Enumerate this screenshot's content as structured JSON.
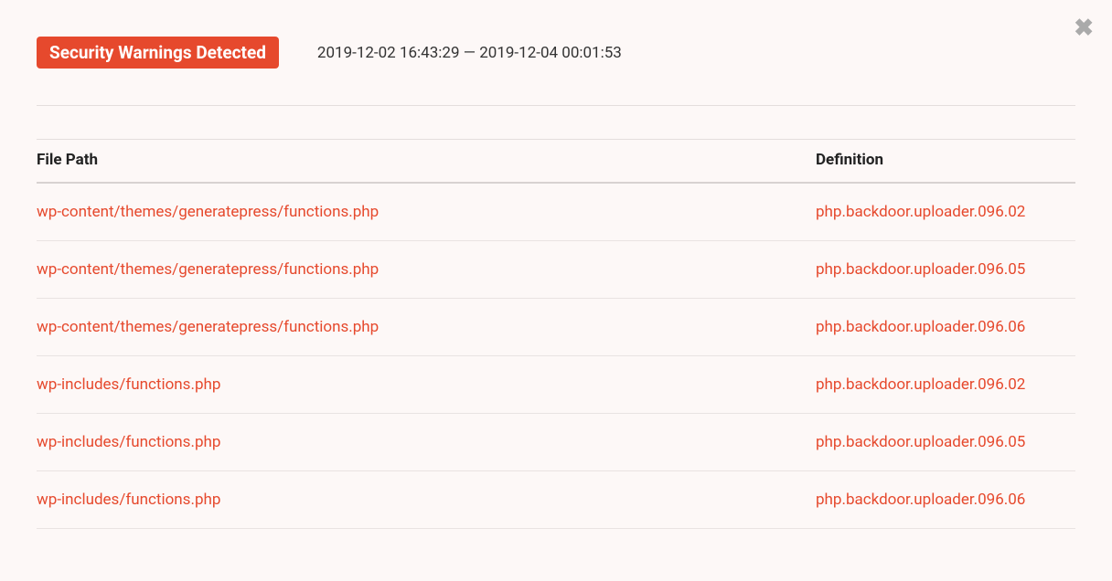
{
  "header": {
    "badge_label": "Security Warnings Detected",
    "timestamp_range": "2019-12-02 16:43:29 — 2019-12-04 00:01:53"
  },
  "close_icon": "✖",
  "table": {
    "columns": {
      "file_path": "File Path",
      "definition": "Definition"
    },
    "rows": [
      {
        "file_path": "wp-content/themes/generatepress/functions.php",
        "definition": "php.backdoor.uploader.096.02"
      },
      {
        "file_path": "wp-content/themes/generatepress/functions.php",
        "definition": "php.backdoor.uploader.096.05"
      },
      {
        "file_path": "wp-content/themes/generatepress/functions.php",
        "definition": "php.backdoor.uploader.096.06"
      },
      {
        "file_path": "wp-includes/functions.php",
        "definition": "php.backdoor.uploader.096.02"
      },
      {
        "file_path": "wp-includes/functions.php",
        "definition": "php.backdoor.uploader.096.05"
      },
      {
        "file_path": "wp-includes/functions.php",
        "definition": "php.backdoor.uploader.096.06"
      }
    ]
  },
  "colors": {
    "accent": "#e6492d",
    "background": "#fdf8f7"
  }
}
